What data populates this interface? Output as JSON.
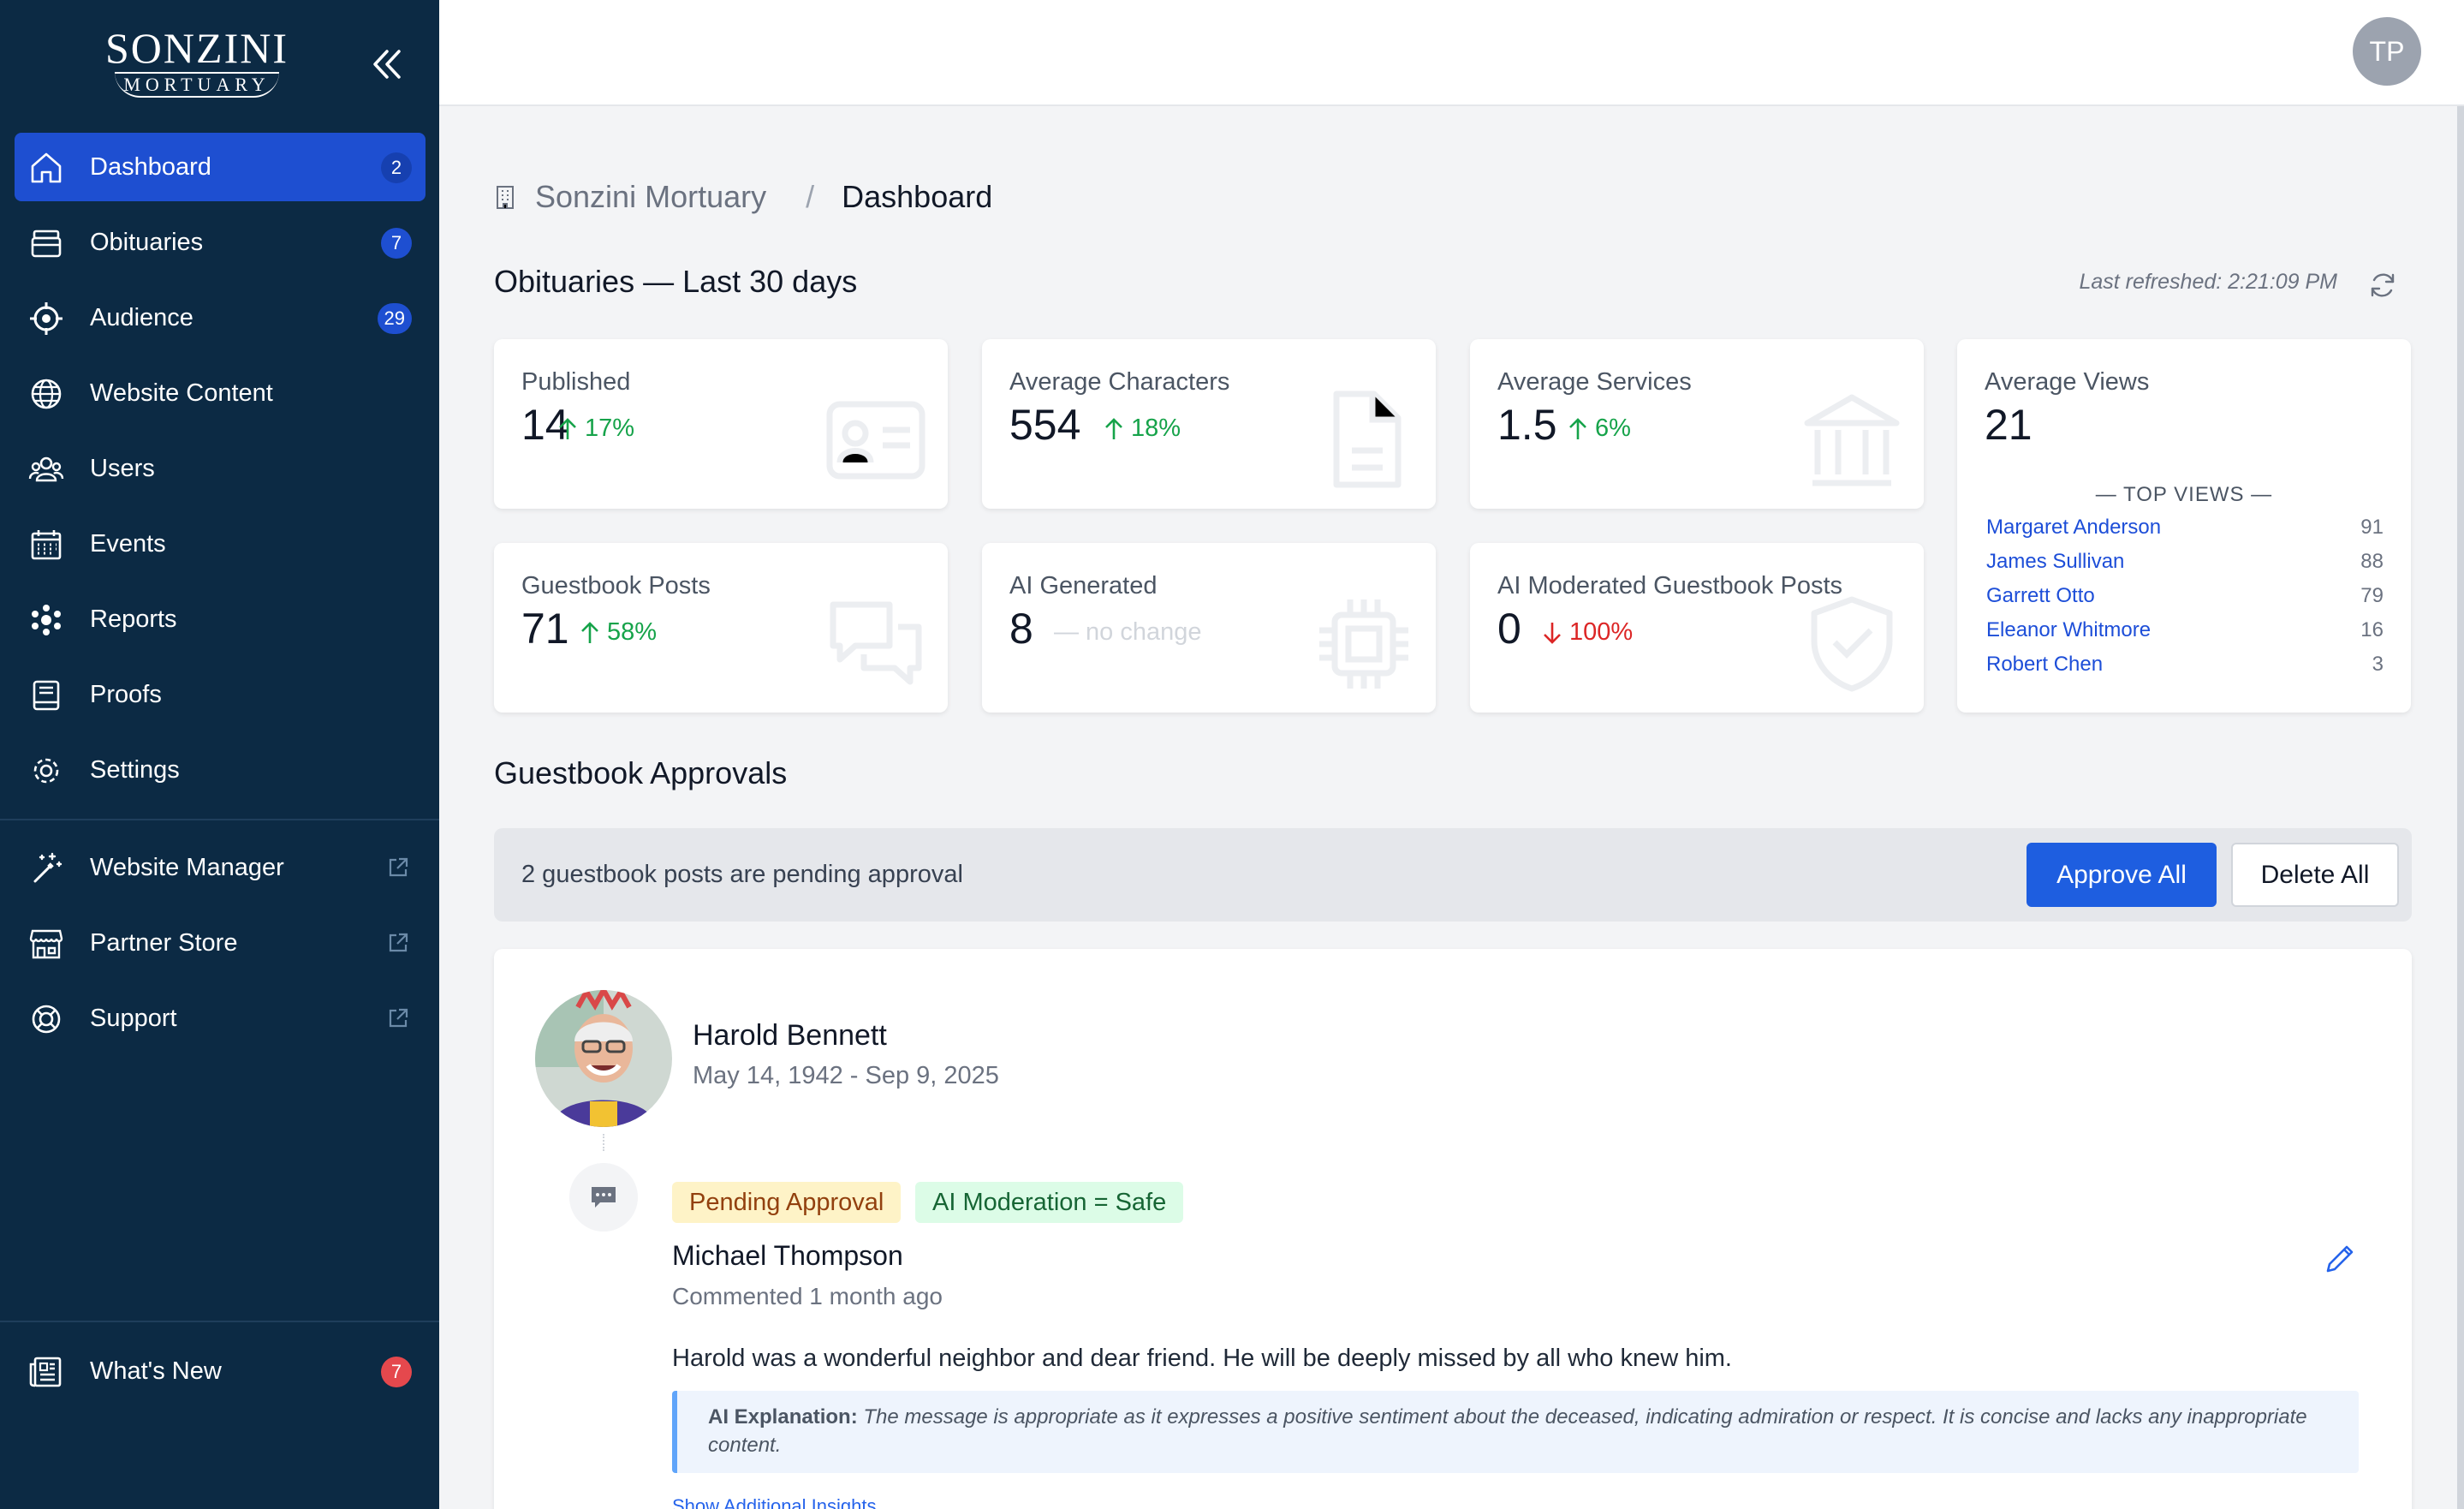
{
  "brand": {
    "name": "SONZINI",
    "subtitle": "MORTUARY"
  },
  "sidebar": {
    "items": [
      {
        "label": "Dashboard",
        "badge": "2",
        "icon": "home-icon",
        "active": true
      },
      {
        "label": "Obituaries",
        "badge": "7",
        "icon": "archive-icon"
      },
      {
        "label": "Audience",
        "badge": "29",
        "icon": "target-icon"
      },
      {
        "label": "Website Content",
        "badge": "",
        "icon": "globe-icon"
      },
      {
        "label": "Users",
        "badge": "",
        "icon": "users-icon"
      },
      {
        "label": "Events",
        "badge": "",
        "icon": "calendar-icon"
      },
      {
        "label": "Reports",
        "badge": "",
        "icon": "reports-icon"
      },
      {
        "label": "Proofs",
        "badge": "",
        "icon": "book-icon"
      },
      {
        "label": "Settings",
        "badge": "",
        "icon": "gear-icon"
      }
    ],
    "external": [
      {
        "label": "Website Manager",
        "icon": "magic-wand-icon"
      },
      {
        "label": "Partner Store",
        "icon": "store-icon"
      },
      {
        "label": "Support",
        "icon": "lifebuoy-icon"
      }
    ],
    "whats_new": {
      "label": "What's New",
      "badge": "7"
    }
  },
  "topbar": {
    "user_initials": "TP"
  },
  "breadcrumb": {
    "org": "Sonzini Mortuary",
    "page": "Dashboard",
    "separator": "/"
  },
  "stats_section": {
    "title": "Obituaries — Last 30 days",
    "last_refreshed": "Last refreshed: 2:21:09 PM",
    "cards": [
      {
        "label": "Published",
        "value": "14",
        "trend": "17%",
        "direction": "up"
      },
      {
        "label": "Average Characters",
        "value": "554",
        "trend": "18%",
        "direction": "up"
      },
      {
        "label": "Average Services",
        "value": "1.5",
        "trend": "6%",
        "direction": "up"
      },
      {
        "label": "Guestbook Posts",
        "value": "71",
        "trend": "58%",
        "direction": "up"
      },
      {
        "label": "AI Generated",
        "value": "8",
        "trend": "— no change",
        "direction": "flat"
      },
      {
        "label": "AI Moderated Guestbook Posts",
        "value": "0",
        "trend": "100%",
        "direction": "down"
      }
    ],
    "views": {
      "label": "Average Views",
      "value": "21",
      "top_label": "— TOP VIEWS —",
      "top": [
        {
          "name": "Margaret Anderson",
          "count": "91"
        },
        {
          "name": "James Sullivan",
          "count": "88"
        },
        {
          "name": "Garrett Otto",
          "count": "79"
        },
        {
          "name": "Eleanor Whitmore",
          "count": "16"
        },
        {
          "name": "Robert Chen",
          "count": "3"
        }
      ]
    }
  },
  "approvals": {
    "title": "Guestbook Approvals",
    "pending_text": "2 guestbook posts are pending approval",
    "approve_all": "Approve All",
    "delete_all": "Delete All",
    "post": {
      "deceased_name": "Harold Bennett",
      "dates": "May 14, 1942 - Sep 9, 2025",
      "tag_status": "Pending Approval",
      "tag_ai": "AI Moderation = Safe",
      "commenter": "Michael Thompson",
      "time": "Commented 1 month ago",
      "message": "Harold was a wonderful neighbor and dear friend. He will be deeply missed by all who knew him.",
      "ai_label": "AI Explanation:",
      "ai_text": "The message is appropriate as it expresses a positive sentiment about the deceased, indicating admiration or respect. It is concise and lacks any inappropriate content.",
      "insights_link": "Show Additional Insights"
    }
  },
  "colors": {
    "sidebar_bg": "#0c2a44",
    "active": "#1e4fd1",
    "trend_up": "#16a34a",
    "trend_down": "#dc2626",
    "badge_red": "#e5484d"
  }
}
